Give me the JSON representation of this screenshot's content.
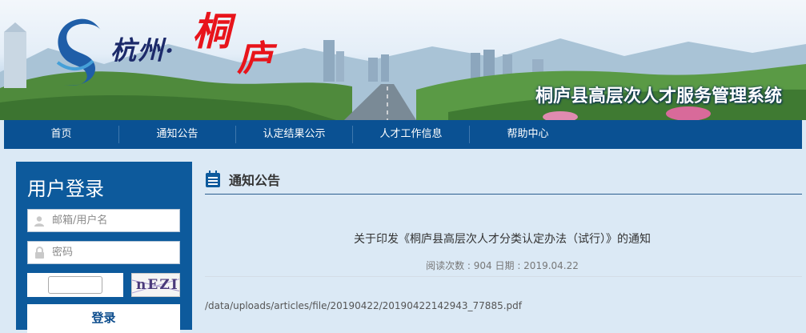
{
  "banner": {
    "logo_hangzhou": "杭州·",
    "logo_tong": "桐",
    "logo_lu": "庐",
    "system_title": "桐庐县高层次人才服务管理系统"
  },
  "nav": {
    "items": [
      {
        "label": "首页"
      },
      {
        "label": "通知公告"
      },
      {
        "label": "认定结果公示"
      },
      {
        "label": "人才工作信息"
      },
      {
        "label": "帮助中心"
      }
    ]
  },
  "login": {
    "title": "用户登录",
    "username_placeholder": "邮箱/用户名",
    "password_placeholder": "密码",
    "captcha_text": "nEZI",
    "submit_label": "登录"
  },
  "notice": {
    "section_title": "通知公告",
    "article_title": "关于印发《桐庐县高层次人才分类认定办法（试行）》的通知",
    "meta": "阅读次数 : 904 日期 : 2019.04.22",
    "file_link": "/data/uploads/articles/file/20190422/20190422142943_77885.pdf"
  },
  "colors": {
    "nav_bg": "#0a5193",
    "login_bg": "#0d5a9c",
    "page_bg": "#dbe9f5",
    "logo_red": "#e8141b"
  }
}
